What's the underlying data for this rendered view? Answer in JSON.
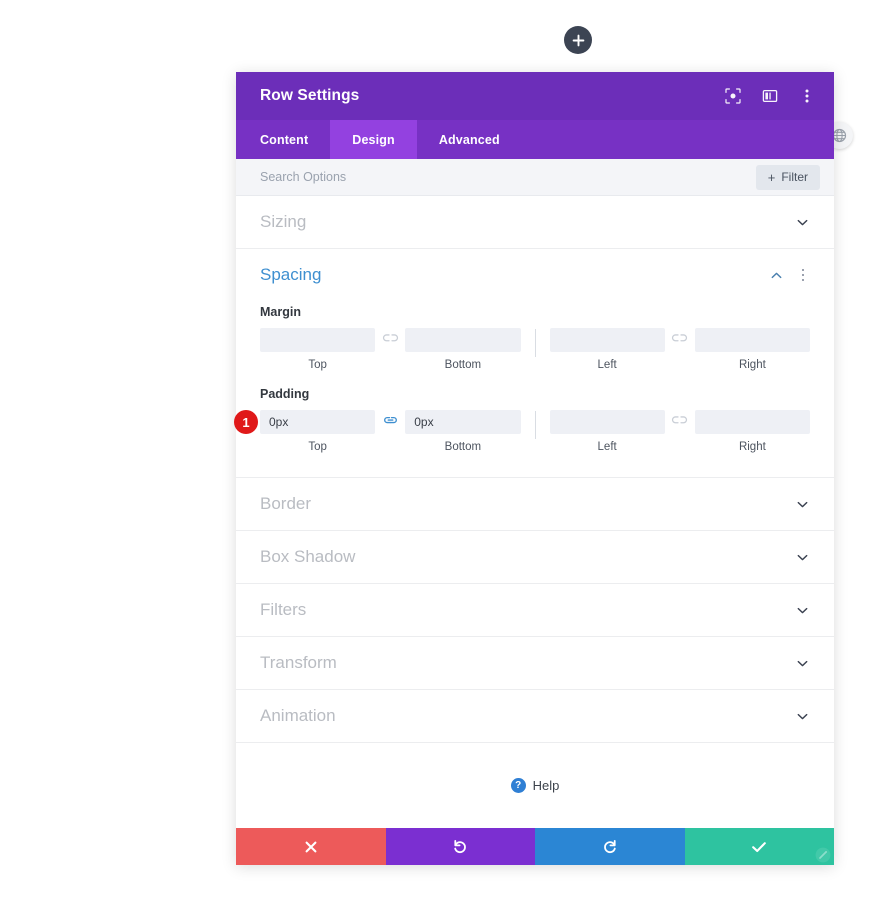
{
  "canvas": {
    "add_button": {
      "icon": "plus-icon",
      "label": "+"
    },
    "globe_badge": {
      "icon": "globe-icon"
    }
  },
  "modal": {
    "title": "Row Settings",
    "header_icons": [
      {
        "name": "focus-icon",
        "label": "Focus"
      },
      {
        "name": "layout-columns-icon",
        "label": "Layout"
      },
      {
        "name": "kebab-menu-icon",
        "label": "More"
      }
    ],
    "tabs": [
      {
        "label": "Content",
        "active": false
      },
      {
        "label": "Design",
        "active": true
      },
      {
        "label": "Advanced",
        "active": false
      }
    ],
    "search": {
      "placeholder": "Search Options",
      "value": ""
    },
    "filter_button": {
      "plus": "+",
      "label": "Filter"
    },
    "sections": [
      {
        "name": "sizing",
        "title": "Sizing",
        "open": false
      },
      {
        "name": "spacing",
        "title": "Spacing",
        "open": true
      },
      {
        "name": "border",
        "title": "Border",
        "open": false
      },
      {
        "name": "box-shadow",
        "title": "Box Shadow",
        "open": false
      },
      {
        "name": "filters",
        "title": "Filters",
        "open": false
      },
      {
        "name": "transform",
        "title": "Transform",
        "open": false
      },
      {
        "name": "animation",
        "title": "Animation",
        "open": false
      }
    ],
    "spacing": {
      "margin": {
        "label": "Margin",
        "top": {
          "value": "",
          "placeholder": "",
          "sublabel": "Top"
        },
        "bottom": {
          "value": "",
          "placeholder": "",
          "sublabel": "Bottom"
        },
        "left": {
          "value": "",
          "placeholder": "",
          "sublabel": "Left"
        },
        "right": {
          "value": "",
          "placeholder": "",
          "sublabel": "Right"
        },
        "link_top_bottom": "unlinked",
        "link_left_right": "unlinked"
      },
      "padding": {
        "label": "Padding",
        "badge": "1",
        "top": {
          "value": "0px",
          "placeholder": "",
          "sublabel": "Top"
        },
        "bottom": {
          "value": "0px",
          "placeholder": "",
          "sublabel": "Bottom"
        },
        "left": {
          "value": "",
          "placeholder": "",
          "sublabel": "Left"
        },
        "right": {
          "value": "",
          "placeholder": "",
          "sublabel": "Right"
        },
        "link_top_bottom": "linked",
        "link_left_right": "unlinked"
      }
    },
    "help": {
      "icon_label": "?",
      "label": "Help"
    },
    "footer": [
      {
        "name": "cancel-button",
        "icon": "close-x-icon",
        "color": "#ed5a5a"
      },
      {
        "name": "undo-button",
        "icon": "undo-arrow-icon",
        "color": "#7b2fd1"
      },
      {
        "name": "redo-button",
        "icon": "redo-arrow-icon",
        "color": "#2b86d4"
      },
      {
        "name": "save-button",
        "icon": "check-icon",
        "color": "#2ec3a0"
      }
    ]
  },
  "colors": {
    "header_purple": "#6c2eb9",
    "tabbar_purple": "#7731c4",
    "tab_active_purple": "#9341e0",
    "section_open_blue": "#3e8fd0",
    "badge_red": "#e01919",
    "link_active_blue": "#3e8fd0"
  }
}
